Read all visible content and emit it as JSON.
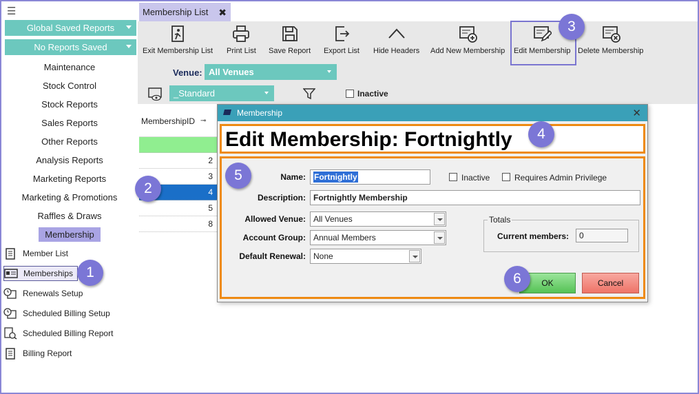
{
  "sidebar": {
    "dropdowns": [
      "Global Saved Reports",
      "No Reports Saved"
    ],
    "nav_items": [
      "Maintenance",
      "Stock Control",
      "Stock Reports",
      "Sales Reports",
      "Other Reports",
      "Analysis Reports",
      "Marketing Reports",
      "Marketing & Promotions",
      "Raffles & Draws",
      "Membership"
    ],
    "sub_items": [
      "Member List",
      "Memberships",
      "Renewals Setup",
      "Scheduled Billing Setup",
      "Scheduled Billing Report",
      "Billing Report"
    ]
  },
  "tab": {
    "label": "Membership List",
    "close": "✖"
  },
  "toolbar": {
    "buttons": [
      "Exit Membership List",
      "Print List",
      "Save Report",
      "Export List",
      "Hide Headers",
      "Add New Membership",
      "Edit Membership",
      "Delete Membership"
    ]
  },
  "filters": {
    "venue_label": "Venue:",
    "venue_value": "All Venues",
    "view_value": "_Standard",
    "inactive_label": "Inactive"
  },
  "grid": {
    "header": "MembershipID",
    "rows": [
      "",
      "2",
      "3",
      "4",
      "5",
      "8"
    ]
  },
  "dialog": {
    "title": "Membership",
    "heading": "Edit Membership: Fortnightly",
    "name_label": "Name:",
    "name_value": "Fortnightly",
    "inactive_label": "Inactive",
    "admin_label": "Requires Admin Privilege",
    "description_label": "Description:",
    "description_value": "Fortnightly Membership",
    "venue_label": "Allowed Venue:",
    "venue_value": "All Venues",
    "account_group_label": "Account Group:",
    "account_group_value": "Annual Members",
    "renewal_label": "Default Renewal:",
    "renewal_value": "None",
    "totals_legend": "Totals",
    "current_members_label": "Current members:",
    "current_members_value": "0",
    "ok_label": "OK",
    "cancel_label": "Cancel"
  },
  "callouts": [
    "1",
    "2",
    "3",
    "4",
    "5",
    "6"
  ],
  "colors": {
    "accent_teal": "#6cc8be",
    "callout_purple": "#7b76d6",
    "highlight_orange": "#ee8a12",
    "title_bar": "#3aa0b8"
  }
}
